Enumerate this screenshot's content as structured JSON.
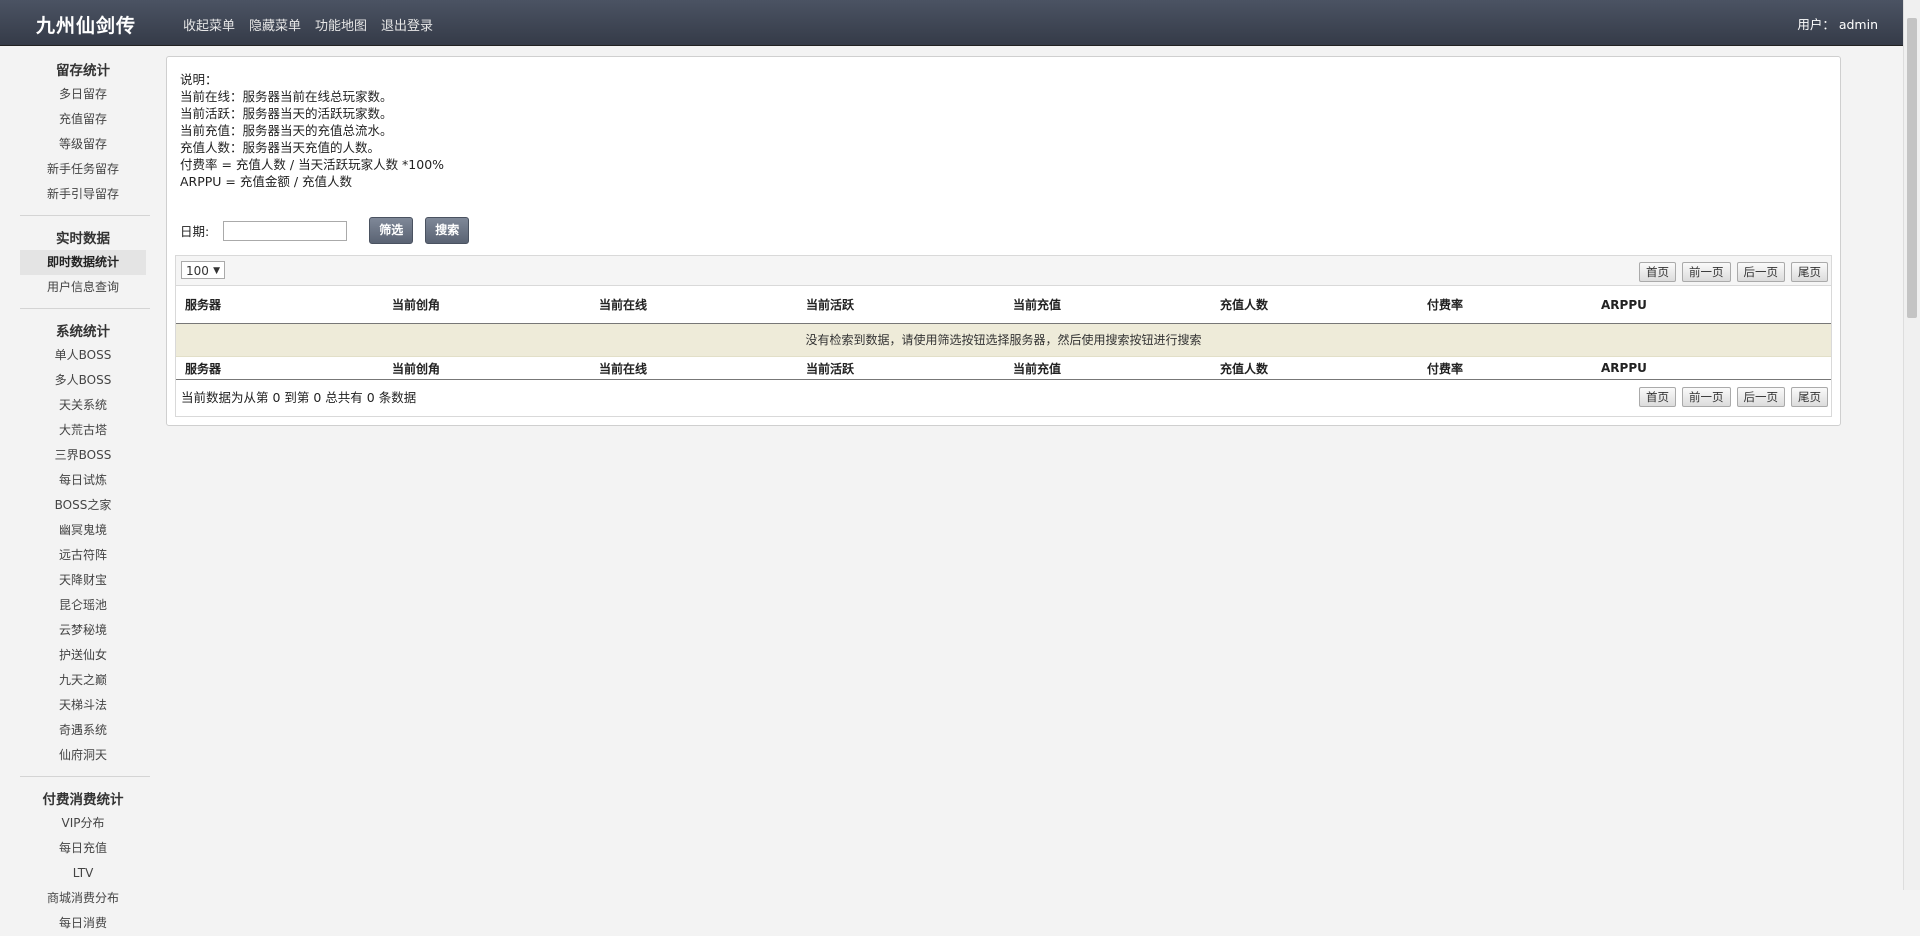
{
  "header": {
    "brand": "九州仙剑传",
    "nav": [
      "收起菜单",
      "隐藏菜单",
      "功能地图",
      "退出登录"
    ],
    "user_label": "用户：",
    "user_name": "admin"
  },
  "sidebar": {
    "groups": [
      {
        "title": "留存统计",
        "items": [
          "多日留存",
          "充值留存",
          "等级留存",
          "新手任务留存",
          "新手引导留存"
        ]
      },
      {
        "title": "实时数据",
        "items": [
          "即时数据统计",
          "用户信息查询"
        ]
      },
      {
        "title": "系统统计",
        "items": [
          "单人BOSS",
          "多人BOSS",
          "天关系统",
          "大荒古塔",
          "三界BOSS",
          "每日试炼",
          "BOSS之家",
          "幽冥鬼境",
          "远古符阵",
          "天降财宝",
          "昆仑瑶池",
          "云梦秘境",
          "护送仙女",
          "九天之巅",
          "天梯斗法",
          "奇遇系统",
          "仙府洞天"
        ]
      },
      {
        "title": "付费消费统计",
        "items": [
          "VIP分布",
          "每日充值",
          "LTV",
          "商城消费分布",
          "每日消费"
        ]
      }
    ],
    "active_item": "即时数据统计"
  },
  "description": {
    "lines": [
      "说明：",
      "当前在线：服务器当前在线总玩家数。",
      "当前活跃：服务器当天的活跃玩家数。",
      "当前充值：服务器当天的充值总流水。",
      "充值人数：服务器当天充值的人数。",
      "付费率 = 充值人数 / 当天活跃玩家人数 *100%",
      "ARPPU = 充值金额 / 充值人数"
    ]
  },
  "filter": {
    "date_label": "日期:",
    "date_value": "",
    "filter_button": "筛选",
    "search_button": "搜索"
  },
  "table": {
    "page_size": "100",
    "pager": [
      "首页",
      "前一页",
      "后一页",
      "尾页"
    ],
    "columns": [
      "服务器",
      "当前创角",
      "当前在线",
      "当前活跃",
      "当前充值",
      "充值人数",
      "付费率",
      "ARPPU"
    ],
    "empty_message": "没有检索到数据，请使用筛选按钮选择服务器，然后使用搜索按钮进行搜索",
    "info": "当前数据为从第 0 到第 0 总共有 0 条数据"
  }
}
